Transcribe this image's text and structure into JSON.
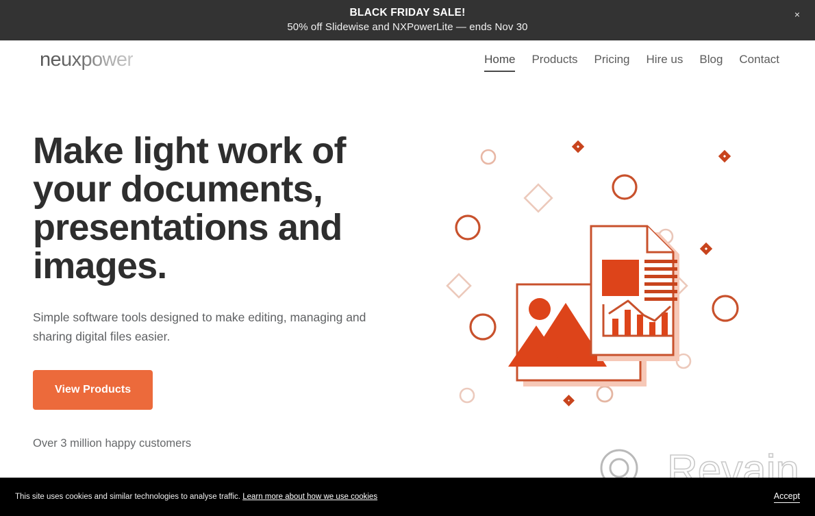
{
  "promo_banner": {
    "title": "BLACK FRIDAY SALE!",
    "subtitle": "50% off Slidewise and NXPowerLite — ends Nov 30",
    "close_label": "×",
    "background_color": "#333333"
  },
  "header": {
    "logo_text": "neuxpower",
    "nav": [
      {
        "label": "Home",
        "active": true
      },
      {
        "label": "Products",
        "active": false
      },
      {
        "label": "Pricing",
        "active": false
      },
      {
        "label": "Hire us",
        "active": false
      },
      {
        "label": "Blog",
        "active": false
      },
      {
        "label": "Contact",
        "active": false
      }
    ]
  },
  "hero": {
    "heading": "Make light work of your documents, presentations and images.",
    "subheading": "Simple software tools designed to make editing, managing and sharing digital files easier.",
    "cta_label": "View Products",
    "note": "Over 3 million happy customers",
    "accent_color": "#ec6a3b",
    "illustration_color": "#d8431a"
  },
  "watermark": {
    "text": "Revain"
  },
  "cookie_bar": {
    "message": "This site uses cookies and similar technologies to analyse traffic.",
    "link_label": "Learn more about how we use cookies",
    "accept_label": "Accept",
    "background_color": "#000000"
  }
}
